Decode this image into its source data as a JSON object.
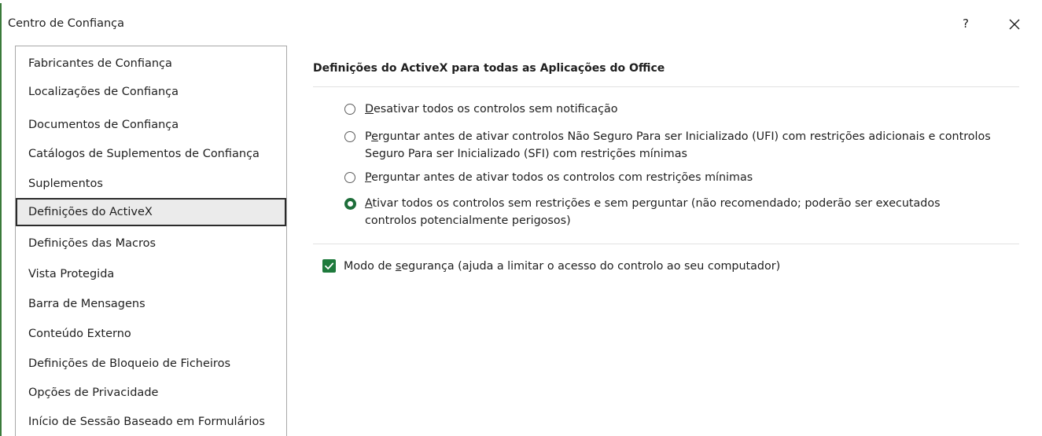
{
  "window": {
    "title": "Centro de Confiança",
    "help_label": "?",
    "accent_color": "#1e7a3c"
  },
  "sidebar": {
    "items": [
      {
        "label": "Fabricantes de Confiança",
        "selected": false
      },
      {
        "label": "Localizações de Confiança",
        "selected": false
      },
      {
        "label": "Documentos de Confiança",
        "selected": false
      },
      {
        "label": "Catálogos de Suplementos de Confiança",
        "selected": false
      },
      {
        "label": "Suplementos",
        "selected": false
      },
      {
        "label": "Definições do ActiveX",
        "selected": true
      },
      {
        "label": "Definições das Macros",
        "selected": false
      },
      {
        "label": "Vista Protegida",
        "selected": false
      },
      {
        "label": "Barra de Mensagens",
        "selected": false
      },
      {
        "label": "Conteúdo Externo",
        "selected": false
      },
      {
        "label": "Definições de Bloqueio de Ficheiros",
        "selected": false
      },
      {
        "label": "Opções de Privacidade",
        "selected": false
      },
      {
        "label": "Início de Sessão Baseado em Formulários",
        "selected": false
      }
    ]
  },
  "main": {
    "section_title": "Definições do ActiveX para todas as Aplicações do Office",
    "options": [
      {
        "first_char": "D",
        "line1_rest": "esativar todos os controlos sem notificação",
        "line2": "",
        "checked": false
      },
      {
        "first_char": "P",
        "underline_char": "e",
        "line1_rest": "rguntar antes de ativar controlos Não Seguro Para ser Inicializado (UFI) com restrições adicionais e controlos",
        "line2": "Seguro Para ser Inicializado (SFI) com restrições mínimas",
        "checked": false
      },
      {
        "first_char": "P",
        "line1_rest": "erguntar antes de ativar todos os controlos com restrições mínimas",
        "line2": "",
        "checked": false
      },
      {
        "first_char": "A",
        "line1_rest": "tivar todos os controlos sem restrições e sem perguntar (não recomendado; poderão ser executados",
        "line2": "controlos potencialmente perigosos)",
        "checked": true
      }
    ],
    "safe_mode": {
      "prefix": "Modo de ",
      "underline_char": "s",
      "suffix": "egurança (ajuda a limitar o acesso do controlo ao seu computador)",
      "checked": true
    }
  }
}
